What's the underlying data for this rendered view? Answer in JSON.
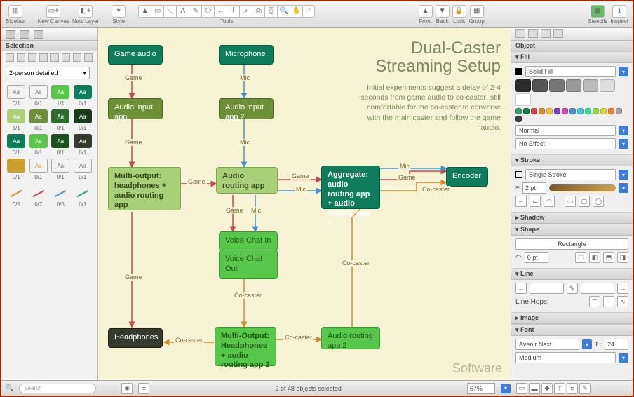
{
  "toolbar": {
    "sidebar": "Sidebar",
    "new_canvas": "New Canvas",
    "new_layer": "New Layer",
    "style": "Style",
    "tools": "Tools",
    "front": "Front",
    "back": "Back",
    "lock": "Lock",
    "group": "Group",
    "stencils": "Stencils",
    "inspect": "Inspect"
  },
  "left": {
    "section": "Selection",
    "dropdown": "2-person detailed",
    "grid": [
      {
        "txt": "Aa",
        "bg": "",
        "cnt": "0/1"
      },
      {
        "txt": "Aa",
        "bg": "",
        "cnt": "0/1"
      },
      {
        "txt": "Aa",
        "bg": "#58c64a",
        "cnt": "1/1"
      },
      {
        "txt": "Aa",
        "bg": "#0f7d5c",
        "cnt": "0/1"
      },
      {
        "txt": "Aa",
        "bg": "#a9cf78",
        "cnt": "1/1"
      },
      {
        "txt": "Aa",
        "bg": "#6e8f37",
        "cnt": "0/1"
      },
      {
        "txt": "Aa",
        "bg": "#2e6b2e",
        "cnt": "0/1"
      },
      {
        "txt": "Aa",
        "bg": "#1b3a1b",
        "cnt": "0/1"
      },
      {
        "txt": "Aa",
        "bg": "#0f7d5c",
        "cnt": "0/1"
      },
      {
        "txt": "Aa",
        "bg": "#58c64a",
        "cnt": "0/1"
      },
      {
        "txt": "Aa",
        "bg": "#1f4f1f",
        "cnt": "0/1"
      },
      {
        "txt": "Aa",
        "bg": "#353b2e",
        "cnt": "0/1"
      },
      {
        "txt": "Aa",
        "bg": "#c9a030",
        "cnt": "0/1",
        "fg": "#c9a030"
      },
      {
        "txt": "Aa",
        "bg": "",
        "cnt": "0/1",
        "fg": "#c9a030"
      },
      {
        "txt": "Aa",
        "bg": "",
        "cnt": "0/1"
      },
      {
        "txt": "Aa",
        "bg": "",
        "cnt": "0/1"
      }
    ],
    "lines": [
      {
        "col": "#d98a2b",
        "cnt": "0/5"
      },
      {
        "col": "#c94848",
        "cnt": "0/7"
      },
      {
        "col": "#4a90d9",
        "cnt": "0/5"
      },
      {
        "col": "#2aa86f",
        "cnt": "0/1"
      }
    ]
  },
  "diagram": {
    "title1": "Dual-Caster",
    "title2": "Streaming Setup",
    "desc": "Initial experiments suggest a delay of 2-4 seconds from game audio to co-caster; still comfortable for the co-caster to converse with the main caster and follow the game audio.",
    "watermark": "Software",
    "nodes": {
      "game_audio": "Game audio",
      "microphone": "Microphone",
      "audio_input": "Audio input app",
      "audio_input2": "Audio input app 2",
      "multi_output": "Multi-output: headphones + audio routing app",
      "audio_routing": "Audio routing app",
      "aggregate": "Aggregate: audio routing app + audio routing app 2",
      "encoder": "Encoder",
      "voice_in": "Voice Chat In",
      "voice_out": "Voice Chat Out",
      "headphones": "Headphones",
      "multi_output2": "Multi-Output: Headphones + audio routing app 2",
      "audio_routing2": "Audio routing app 2"
    },
    "labels": {
      "game": "Game",
      "mic": "Mic",
      "co": "Co-caster"
    }
  },
  "inspector": {
    "object": "Object",
    "fill": {
      "label": "Fill",
      "type": "Solid Fill",
      "blend": "Normal",
      "effect": "No Effect",
      "big": [
        "#2b2b2b",
        "#555",
        "#777",
        "#999",
        "#bbb",
        "#ddd",
        "#fff"
      ],
      "small": [
        "#2aa86f",
        "#1a7a4f",
        "#c94848",
        "#d98a2b",
        "#f0c040",
        "#7a3fd0",
        "#d048c0",
        "#4a90d9",
        "#40c8d8",
        "#40d890",
        "#90d840",
        "#d8d840",
        "#f08030",
        "#a0a0a0",
        "#404040"
      ]
    },
    "stroke": {
      "label": "Stroke",
      "type": "Single Stroke",
      "width": "2 pt"
    },
    "shadow": {
      "label": "Shadow"
    },
    "shape": {
      "label": "Shape",
      "type": "Rectangle",
      "radius": "6 pt"
    },
    "line": {
      "label": "Line",
      "hops": "Line Hops:"
    },
    "image": {
      "label": "Image"
    },
    "font": {
      "label": "Font",
      "family": "Avenir Next",
      "size": "24",
      "weight": "Medium"
    }
  },
  "status": {
    "search": "Search",
    "selection": "2 of 48 objects selected",
    "zoom": "67%"
  }
}
